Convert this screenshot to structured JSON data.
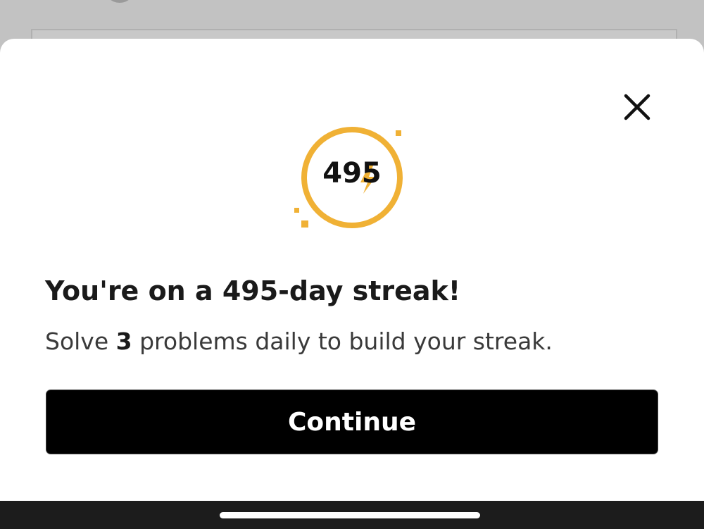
{
  "streak_modal": {
    "streak_count": "495",
    "title": "You're on a 495-day streak!",
    "subtitle_prefix": "Solve ",
    "subtitle_count": "3",
    "subtitle_suffix": " problems daily to build your streak.",
    "continue_label": "Continue"
  },
  "icons": {
    "close": "close-icon",
    "streak_badge": "streak-badge-icon",
    "bolt": "lightning-bolt-icon"
  },
  "colors": {
    "accent": "#F0B135",
    "button_bg": "#000000",
    "button_text": "#FFFFFF",
    "title_text": "#1A1A1A",
    "body_text": "#3A3A3A"
  }
}
